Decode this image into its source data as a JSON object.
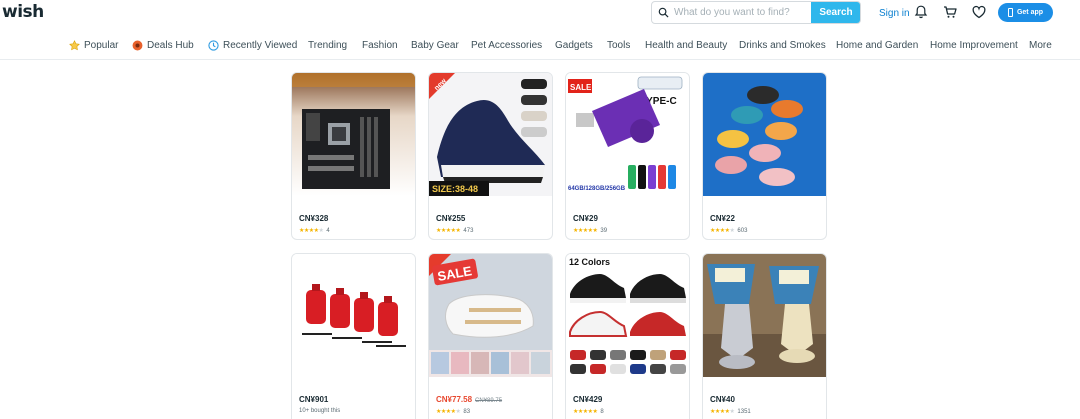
{
  "header": {
    "logo": "wish",
    "search_placeholder": "What do you want to find?",
    "search_button": "Search",
    "signin": "Sign in",
    "get_app": "Get app"
  },
  "nav": {
    "items": [
      {
        "label": "Popular",
        "icon": "star-icon"
      },
      {
        "label": "Deals Hub",
        "icon": "deals-icon"
      },
      {
        "label": "Recently Viewed",
        "icon": "clock-icon"
      },
      {
        "label": "Trending"
      },
      {
        "label": "Fashion"
      },
      {
        "label": "Baby Gear"
      },
      {
        "label": "Pet Accessories"
      },
      {
        "label": "Gadgets"
      },
      {
        "label": "Tools"
      },
      {
        "label": "Health and Beauty"
      },
      {
        "label": "Drinks and Smokes"
      },
      {
        "label": "Home and Garden"
      },
      {
        "label": "Home Improvement"
      },
      {
        "label": "More"
      }
    ]
  },
  "products": [
    {
      "image": "motherboard",
      "price": "CN¥328",
      "stars": 4,
      "rating_count": "4"
    },
    {
      "image": "sneakers-navy",
      "price": "CN¥255",
      "stars": 5,
      "rating_count": "473",
      "badge": "new",
      "overlay_text": "SIZE:38-48"
    },
    {
      "image": "usb-flash-drive",
      "price": "CN¥29",
      "stars": 5,
      "rating_count": "39",
      "badge": "SALE",
      "overlay_text": "TYPE-C",
      "caption": "64GB/128GB/256GB"
    },
    {
      "image": "bath-slippers",
      "price": "CN¥22",
      "stars": 4,
      "rating_count": "603"
    },
    {
      "image": "fuel-cans",
      "price": "CN¥901",
      "bought_text": "10+ bought this"
    },
    {
      "image": "white-sandals",
      "price": "CN¥77.58",
      "old_price": "CN¥89.75",
      "sale": true,
      "stars": 4,
      "rating_count": "83",
      "badge": "SALE"
    },
    {
      "image": "basketball-shoes",
      "price": "CN¥429",
      "stars": 5,
      "rating_count": "8",
      "overlay_text": "12 Colors"
    },
    {
      "image": "glue-tubes",
      "price": "CN¥40",
      "stars": 4,
      "rating_count": "1351"
    }
  ],
  "colors": {
    "accent": "#2fb7ec",
    "get_app": "#1b8ee6",
    "link": "#0a7fd0",
    "sale_price": "#e8482f",
    "star": "#f5b400"
  }
}
